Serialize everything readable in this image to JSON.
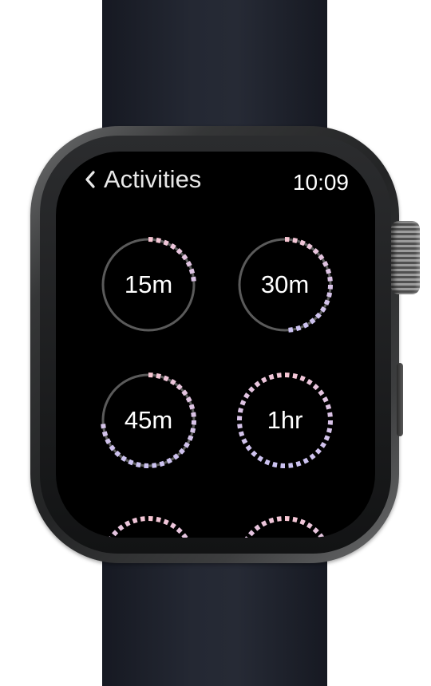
{
  "header": {
    "back_label": "Activities",
    "time": "10:09"
  },
  "colors": {
    "progress_start": "#f7c6d3",
    "progress_end": "#cbc2f0",
    "track": "#5a5a5a",
    "screen_bg": "#000000"
  },
  "activities": [
    {
      "label": "15m",
      "progress": 0.25
    },
    {
      "label": "30m",
      "progress": 0.5
    },
    {
      "label": "45m",
      "progress": 0.75
    },
    {
      "label": "1hr",
      "progress": 1.0
    },
    {
      "label": "",
      "progress": 1.0
    },
    {
      "label": "",
      "progress": 1.0
    }
  ]
}
